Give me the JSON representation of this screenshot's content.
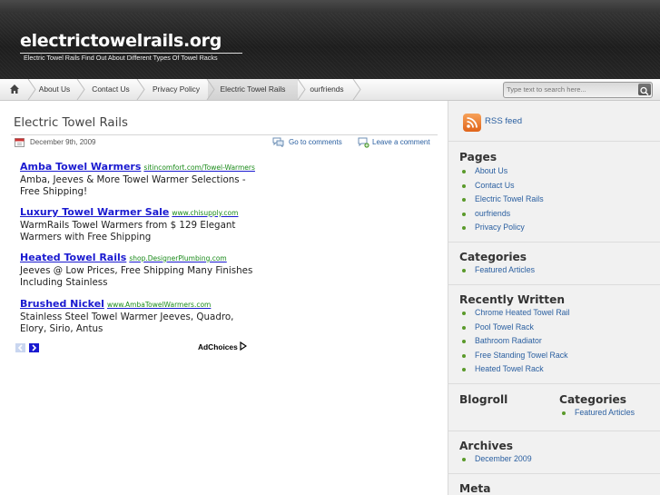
{
  "site": {
    "title": "electrictowelrails.org",
    "description": "Electric Towel Rails Find Out About Different Types Of Towel Racks"
  },
  "nav": {
    "home_icon": "home-icon",
    "items": [
      "About Us",
      "Contact Us",
      "Privacy Policy",
      "Electric Towel Rails",
      "ourfriends"
    ],
    "active": "Electric Towel Rails"
  },
  "search": {
    "placeholder": "Type text to search here..."
  },
  "post": {
    "title": "Electric Towel Rails",
    "date": "December 9th, 2009",
    "goto_comments": "Go to comments",
    "leave_comment": "Leave a comment"
  },
  "ads": [
    {
      "title": "Amba Towel Warmers",
      "url": "sitincomfort.com/Towel-Warmers",
      "body": "Amba, Jeeves & More Towel Warmer Selections - Free Shipping!"
    },
    {
      "title": "Luxury Towel Warmer Sale",
      "url": "www.chisupply.com",
      "body": "WarmRails Towel Warmers from $ 129 Elegant Warmers with Free Shipping"
    },
    {
      "title": "Heated Towel Rails",
      "url": "shop.DesignerPlumbing.com",
      "body": "Jeeves @ Low Prices, Free Shipping Many Finishes Including Stainless"
    },
    {
      "title": "Brushed Nickel",
      "url": "www.AmbaTowelWarmers.com",
      "body": "Stainless Steel Towel Warmer Jeeves, Quadro, Elory, Sirio, Antus"
    }
  ],
  "adchoices": "AdChoices",
  "sidebar": {
    "rss": "RSS feed",
    "pages": {
      "title": "Pages",
      "items": [
        "About Us",
        "Contact Us",
        "Electric Towel Rails",
        "ourfriends",
        "Privacy Policy"
      ]
    },
    "categories": {
      "title": "Categories",
      "items": [
        "Featured Articles"
      ]
    },
    "recent": {
      "title": "Recently Written",
      "items": [
        "Chrome Heated Towel Rail",
        "Pool Towel Rack",
        "Bathroom Radiator",
        "Free Standing Towel Rack",
        "Heated Towel Rack"
      ]
    },
    "blogroll": {
      "title": "Blogroll"
    },
    "categories2": {
      "title": "Categories",
      "items": [
        "Featured Articles"
      ]
    },
    "archives": {
      "title": "Archives",
      "items": [
        "December 2009"
      ]
    },
    "meta": {
      "title": "Meta"
    }
  },
  "colors": {
    "link": "#2a5fa0",
    "ad_link": "#1a1ad0",
    "ad_url": "#1a8a1a",
    "bullet": "#5a9a2a",
    "rss": "#e0641a"
  }
}
